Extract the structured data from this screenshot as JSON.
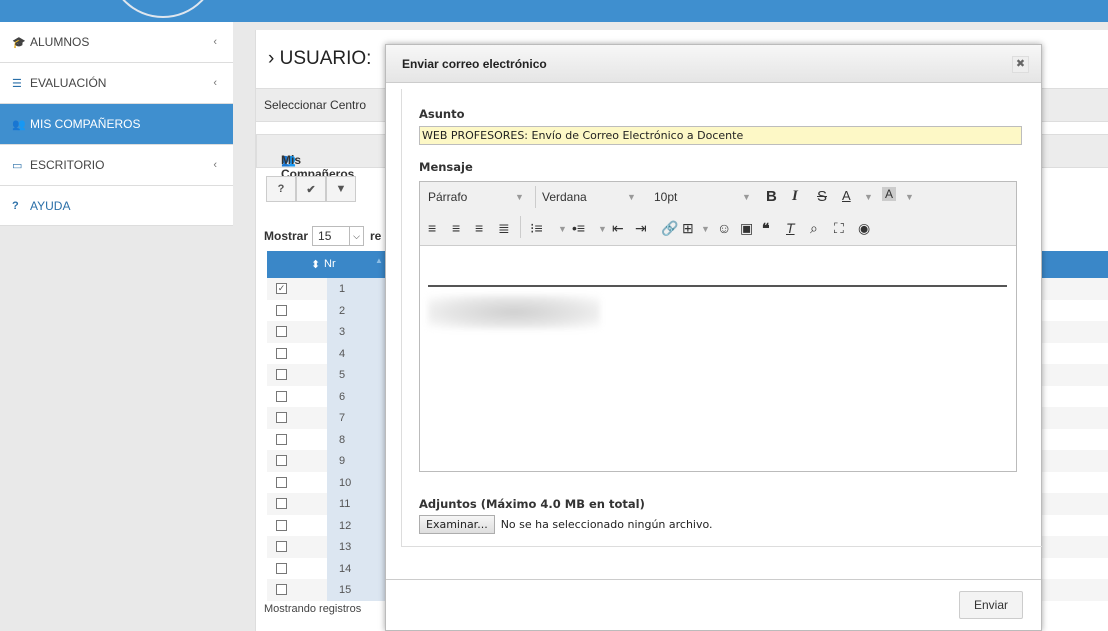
{
  "sidebar": {
    "items": [
      {
        "label": "ALUMNOS",
        "icon": "graduation-cap-icon",
        "chevron": "‹"
      },
      {
        "label": "EVALUACIÓN",
        "icon": "list-icon",
        "chevron": "‹"
      },
      {
        "label": "MIS COMPAÑEROS",
        "icon": "users-icon",
        "chevron": ""
      },
      {
        "label": "ESCRITORIO",
        "icon": "desktop-icon",
        "chevron": "‹"
      },
      {
        "label": "AYUDA",
        "icon": "question-icon",
        "chevron": ""
      }
    ]
  },
  "main": {
    "title": "USUARIO:",
    "select_center": "Seleccionar Centro",
    "panel_title": "Mis Compañeros",
    "toolbar_buttons": [
      "?",
      "✔",
      "▼"
    ],
    "show_label": "Mostrar",
    "show_value": "15",
    "show_tail": "re",
    "table_header": "Nr",
    "rows": [
      "1",
      "2",
      "3",
      "4",
      "5",
      "6",
      "7",
      "8",
      "9",
      "10",
      "11",
      "12",
      "13",
      "14",
      "15"
    ],
    "checked_rows": [
      1
    ],
    "footer": "Mostrando registros"
  },
  "modal": {
    "title": "Enviar correo electrónico",
    "close": "✖",
    "subject_label": "Asunto",
    "subject_value": "WEB PROFESORES: Envío de Correo Electrónico a Docente",
    "message_label": "Mensaje",
    "format": "Párrafo",
    "font": "Verdana",
    "size": "10pt",
    "attachments_label": "Adjuntos (Máximo 4.0 MB en total)",
    "browse_button": "Examinar...",
    "no_file": "No se ha seleccionado ningún archivo.",
    "send_button": "Enviar"
  },
  "colors": {
    "accent": "#3f8fcf",
    "table_header": "#3a87c8",
    "subject_bg": "#fdf8c6"
  }
}
